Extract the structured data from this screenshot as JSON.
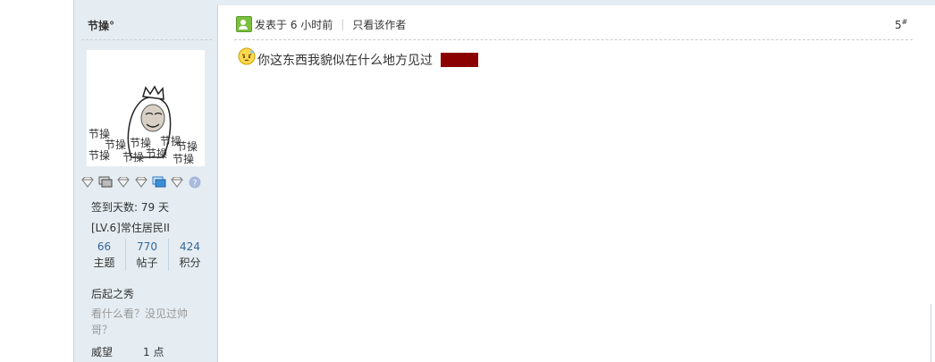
{
  "author": {
    "name": "节操°",
    "avatar_text": "节操",
    "medals": [
      {
        "icon": "diamond-medal-icon",
        "color": "#888888"
      },
      {
        "icon": "stack-medal-icon",
        "color": "#666666"
      },
      {
        "icon": "diamond-medal-icon",
        "color": "#888888"
      },
      {
        "icon": "diamond-medal-icon",
        "color": "#888888"
      },
      {
        "icon": "blue-stack-medal-icon",
        "color": "#3b8fd9"
      },
      {
        "icon": "diamond-medal-icon",
        "color": "#888888"
      },
      {
        "icon": "chat-bubble-icon",
        "color": "#a9b9dd"
      }
    ],
    "sign_days": "签到天数: 79 天",
    "level": "[LV.6]常住居民II",
    "stats": [
      {
        "value": "66",
        "label": "主题"
      },
      {
        "value": "770",
        "label": "帖子"
      },
      {
        "value": "424",
        "label": "积分"
      }
    ],
    "title": "后起之秀",
    "signature": "看什么看？没见过帅哥？",
    "prestige_label": "威望",
    "prestige_value": "1 点"
  },
  "post": {
    "time": "发表于 6 小时前",
    "only_author": "只看该作者",
    "floor": "5",
    "floor_sup": "#",
    "body_text": "你这东西我貌似在什么地方见过",
    "hidden_color": "#8b0000"
  }
}
